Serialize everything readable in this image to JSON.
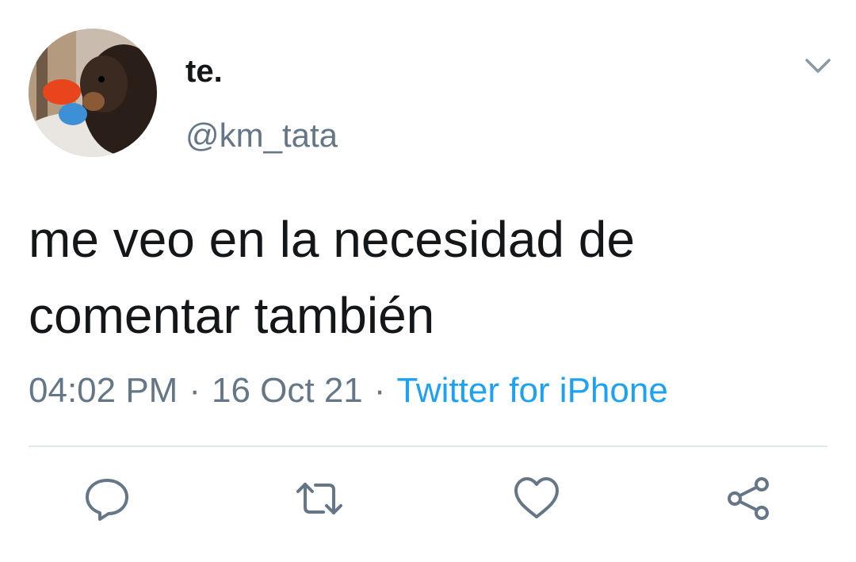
{
  "author": {
    "display_name": "te.",
    "handle": "@km_tata",
    "avatar_icon": "pomeranian-dog-photo"
  },
  "tweet": {
    "text_line1": "me veo en la necesidad de",
    "text_line2": "comentar también",
    "time": "04:02 PM",
    "date": "16 Oct 21",
    "separator": "·",
    "source": "Twitter for iPhone"
  },
  "icons": {
    "menu": "chevron-down-icon",
    "reply": "reply-icon",
    "retweet": "retweet-icon",
    "like": "heart-icon",
    "share": "share-icon"
  },
  "colors": {
    "text_primary": "#14171a",
    "text_secondary": "#657786",
    "link": "#1da1f2",
    "divider": "#e1e8ed"
  }
}
